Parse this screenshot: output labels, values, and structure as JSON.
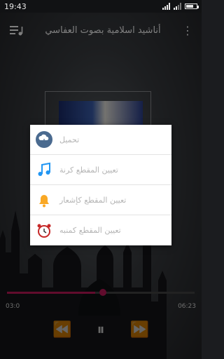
{
  "status_bar": {
    "time": "19:43"
  },
  "app_bar": {
    "title": "أناشيد اسلامية بصوت العفاسي"
  },
  "player": {
    "elapsed": "03:0",
    "duration": "06:23",
    "progress": 0.47
  },
  "dialog": {
    "items": [
      {
        "label": "تحميل",
        "icon": "cloud-download-icon"
      },
      {
        "label": "تعيين المقطع كرنة",
        "icon": "music-note-icon"
      },
      {
        "label": "تعيين المقطع كإشعار",
        "icon": "bell-icon"
      },
      {
        "label": "تعيين المقطع كمنبه",
        "icon": "alarm-clock-icon"
      }
    ]
  },
  "colors": {
    "accent": "#c2185b",
    "download": "#4a6a8f",
    "note": "#2196f3",
    "bell": "#f9a825",
    "alarm": "#c62828"
  }
}
